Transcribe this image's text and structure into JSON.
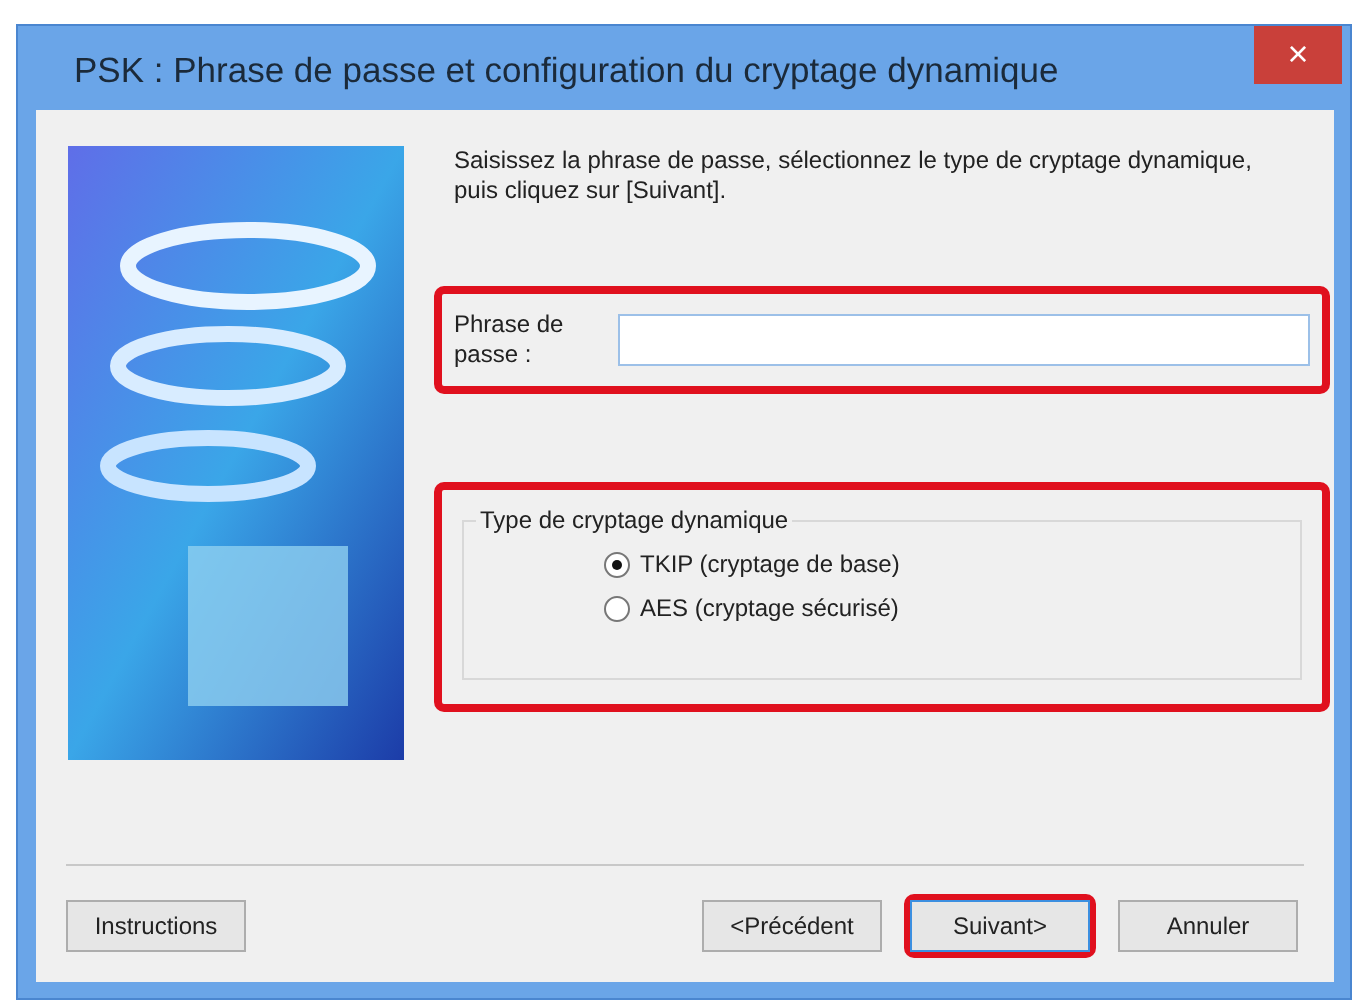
{
  "window": {
    "title": "PSK : Phrase de passe et configuration du cryptage dynamique",
    "close": "×"
  },
  "instruction": "Saisissez la phrase de passe, sélectionnez le type de cryptage dynamique, puis cliquez sur [Suivant].",
  "passphrase": {
    "label": "Phrase de passe :",
    "highlighted": true
  },
  "encryption": {
    "title": "Type de cryptage dynamique",
    "highlighted": true,
    "options": [
      {
        "label": "TKIP (cryptage de base)",
        "selected": true
      },
      {
        "label": "AES (cryptage sécurisé)",
        "selected": false
      }
    ]
  },
  "buttons": [
    {
      "label": "Instructions",
      "kind": "left"
    },
    {
      "label": "<Précédent",
      "kind": "right",
      "highlighted": false
    },
    {
      "label": "Suivant>",
      "kind": "right",
      "highlighted": true
    },
    {
      "label": "Annuler",
      "kind": "right",
      "highlighted": false
    }
  ]
}
